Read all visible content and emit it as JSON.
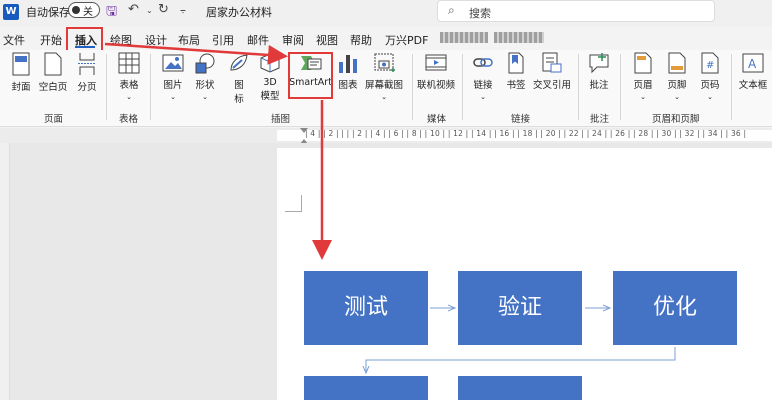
{
  "titlebar": {
    "app_icon": "W",
    "autosave_label": "自动保存",
    "autosave_state": "关",
    "doc_title": "居家办公材料",
    "search_placeholder": "搜索"
  },
  "tabs": [
    "文件",
    "开始",
    "插入",
    "绘图",
    "设计",
    "布局",
    "引用",
    "邮件",
    "审阅",
    "视图",
    "帮助",
    "万兴PDF"
  ],
  "active_tab": "插入",
  "ribbon": {
    "page_group": {
      "label": "页面",
      "buttons": [
        "封面",
        "空白页",
        "分页"
      ]
    },
    "table_group": {
      "label": "表格",
      "buttons": [
        "表格"
      ]
    },
    "illustration_group": {
      "label": "插图",
      "buttons": [
        "图片",
        "形状",
        "图标",
        "3D 模型",
        "SmartArt",
        "图表",
        "屏幕截图"
      ]
    },
    "media_group": {
      "label": "媒体",
      "buttons": [
        "联机视频"
      ]
    },
    "link_group": {
      "label": "链接",
      "buttons": [
        "链接",
        "书签",
        "交叉引用"
      ]
    },
    "comment_group": {
      "label": "批注",
      "buttons": [
        "批注"
      ]
    },
    "header_group": {
      "label": "页眉和页脚",
      "buttons": [
        "页眉",
        "页脚",
        "页码"
      ]
    },
    "text_group": {
      "buttons": [
        "文本框"
      ]
    }
  },
  "ruler_text": "| 4 |  | 2 |  |  |  | 2 |  | 4 |  | 6 |  | 8 |  | 10 |  | 12 |  | 14 |  | 16 |  | 18 |  | 20 |  | 22 |  | 24 |  | 26 |  | 28 |  | 30 |  | 32 |  | 34 |  | 36 |",
  "smartart": {
    "boxes": [
      "测试",
      "验证",
      "优化"
    ]
  },
  "colors": {
    "accent": "#e03a3a",
    "shape_fill": "#4472c4",
    "word_blue": "#185abd"
  }
}
